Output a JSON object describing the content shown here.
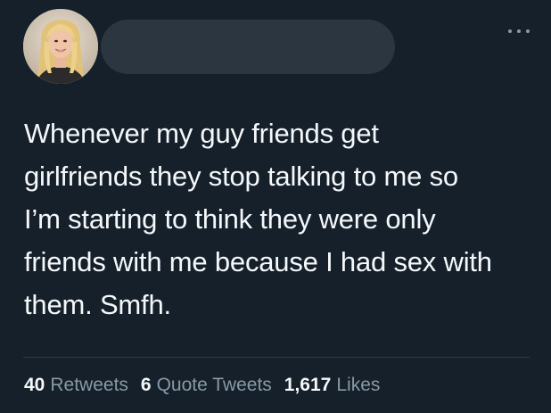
{
  "tweet": {
    "author": {
      "avatar_icon": "user-avatar-photo",
      "name_redacted": true
    },
    "menu_icon": "more-options-icon",
    "text": "Whenever my guy friends get\ngirlfriends they stop talking to me so\nI’m starting to think they were only\nfriends with me because I had sex with\nthem. Smfh.",
    "stats": {
      "retweets": {
        "count": "40",
        "label": "Retweets"
      },
      "quote_tweets": {
        "count": "6",
        "label": "Quote Tweets"
      },
      "likes": {
        "count": "1,617",
        "label": "Likes"
      }
    }
  },
  "colors": {
    "background": "#15202b",
    "text": "#f5f8fa",
    "secondary_text": "#8899a6",
    "divider": "#2f3b47",
    "redaction": "#2c3640"
  }
}
